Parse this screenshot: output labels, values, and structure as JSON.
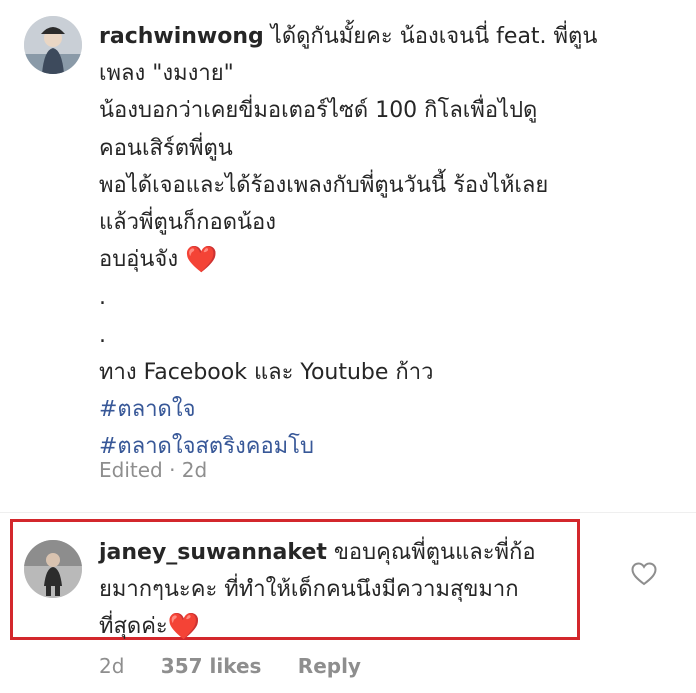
{
  "comment": {
    "username": "rachwinwong",
    "lines": [
      "ได้ดูกันมั้ยคะ น้องเจนนี่ feat. พี่ตูน",
      "เพลง \"งมงาย\"",
      "น้องบอกว่าเคยขี่มอเตอร์ไซด์ 100 กิโลเพื่อไปดู",
      "คอนเสิร์ตพี่ตูน",
      "พอได้เจอและได้ร้องเพลงกับพี่ตูนวันนี้ ร้องไห้เลย",
      "แล้วพี่ตูนก็กอดน้อง",
      "อบอุ่นจัง",
      ".",
      ".",
      "ทาง Facebook และ Youtube ก้าว"
    ],
    "heart": "❤️",
    "hashtags": [
      "#ตลาดใจ",
      "#ตลาดใจสตริงคอมโบ"
    ],
    "meta": "Edited · 2d"
  },
  "reply": {
    "username": "janey_suwannaket",
    "lines": [
      "ขอบคุณพี่ตูนและพี่ก้อ",
      "ยมากๆนะคะ ที่ทำให้เด็กคนนึงมีความสุขมาก",
      "ที่สุดค่ะ"
    ],
    "heart": "❤️",
    "time": "2d",
    "likes": "357 likes",
    "reply_label": "Reply"
  },
  "icons": {
    "like": "heart-outline-icon",
    "highlight_color": "#d3272c",
    "hashtag_color": "#385898"
  }
}
